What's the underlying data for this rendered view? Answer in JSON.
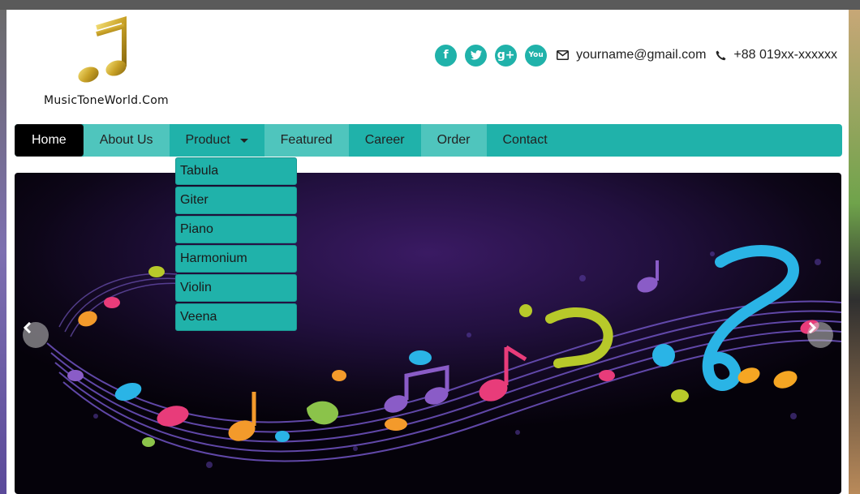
{
  "brand": {
    "name": "MusicToneWorld.Com"
  },
  "contact": {
    "social": [
      {
        "name": "facebook-icon",
        "glyph": "f"
      },
      {
        "name": "twitter-icon",
        "glyph": "t"
      },
      {
        "name": "google-plus-icon",
        "glyph": "g+"
      },
      {
        "name": "youtube-icon",
        "glyph": "You"
      }
    ],
    "email": "yourname@gmail.com",
    "phone": "+88 019xx-xxxxxx"
  },
  "nav": {
    "items": [
      "Home",
      "About Us",
      "Product",
      "Featured",
      "Career",
      "Order",
      "Contact"
    ],
    "active": "Home",
    "open_dropdown": "Product"
  },
  "dropdown": {
    "items": [
      "Tabula",
      "Giter",
      "Piano",
      "Harmonium",
      "Violin",
      "Veena"
    ]
  },
  "colors": {
    "accent": "#20b2aa",
    "accent_light": "#4fc5bd",
    "active": "#000000"
  },
  "slider": {
    "prev_icon": "chevron-left-icon",
    "next_icon": "chevron-right-icon"
  }
}
